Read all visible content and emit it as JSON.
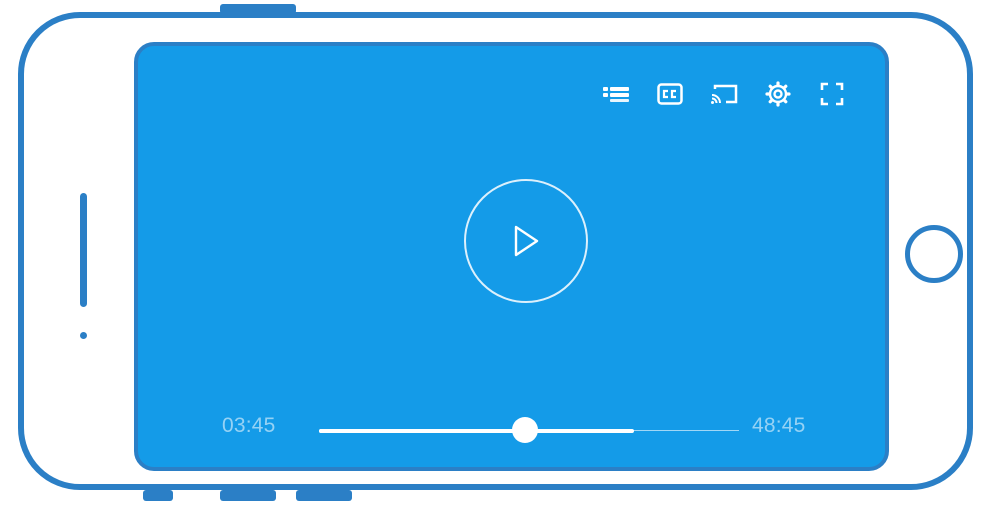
{
  "player": {
    "current_time": "03:45",
    "total_time": "48:45",
    "played_fraction": 0.49,
    "buffered_fraction": 0.75
  },
  "toolbar": {
    "icons": [
      "playlist-icon",
      "subtitles-icon",
      "cast-icon",
      "settings-icon",
      "fullscreen-icon"
    ]
  },
  "colors": {
    "frame": "#2b7fc6",
    "screen": "#149be8",
    "controls": "#ffffff"
  }
}
